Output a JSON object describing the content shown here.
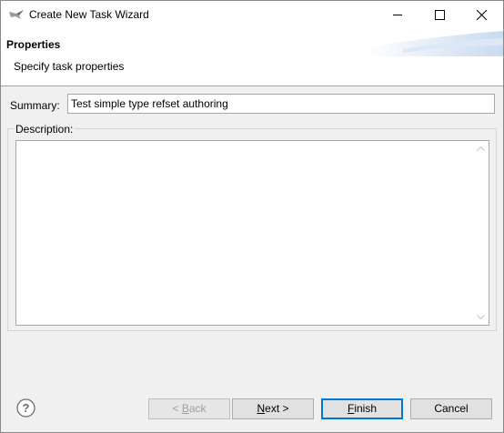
{
  "window": {
    "title": "Create New Task Wizard",
    "minimize_icon": "minimize-icon",
    "maximize_icon": "maximize-icon",
    "close_icon": "close-icon"
  },
  "header": {
    "title": "Properties",
    "description": "Specify task properties"
  },
  "form": {
    "summary_label": "Summary:",
    "summary_value": "Test simple type refset authoring",
    "description_label": "Description:",
    "description_value": ""
  },
  "footer": {
    "help_icon": "help-icon",
    "back": {
      "prefix": "< ",
      "mnemonic": "B",
      "rest": "ack",
      "enabled": false
    },
    "next": {
      "mnemonic": "N",
      "rest": "ext >",
      "enabled": true
    },
    "finish": {
      "mnemonic": "F",
      "rest": "inish",
      "enabled": true,
      "default": true
    },
    "cancel": {
      "label": "Cancel",
      "enabled": true
    }
  },
  "colors": {
    "accent": "#0078d7",
    "dialog_bg": "#f0f0f0",
    "header_bg": "#ffffff"
  }
}
